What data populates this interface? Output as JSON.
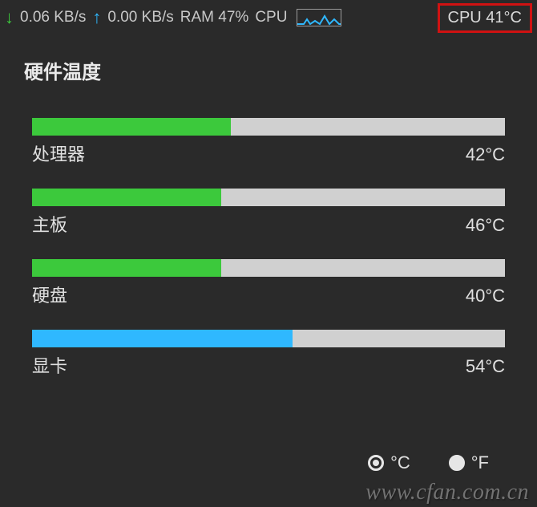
{
  "topbar": {
    "down_speed": "0.06 KB/s",
    "up_speed": "0.00 KB/s",
    "ram_label": "RAM 47%",
    "cpu_label": "CPU",
    "cpu_temp_box": "CPU 41°C"
  },
  "section_title": "硬件温度",
  "bars": [
    {
      "label": "处理器",
      "value": "42°C",
      "fill_pct": 42,
      "color": "green"
    },
    {
      "label": "主板",
      "value": "46°C",
      "fill_pct": 40,
      "color": "green"
    },
    {
      "label": "硬盘",
      "value": "40°C",
      "fill_pct": 40,
      "color": "green"
    },
    {
      "label": "显卡",
      "value": "54°C",
      "fill_pct": 55,
      "color": "blue"
    }
  ],
  "unit_toggle": {
    "celsius_label": "°C",
    "fahrenheit_label": "°F",
    "selected": "celsius"
  },
  "watermark": "www.cfan.com.cn",
  "colors": {
    "highlight_border": "#d01212",
    "green": "#3cc93c",
    "blue": "#2fb8ff"
  }
}
